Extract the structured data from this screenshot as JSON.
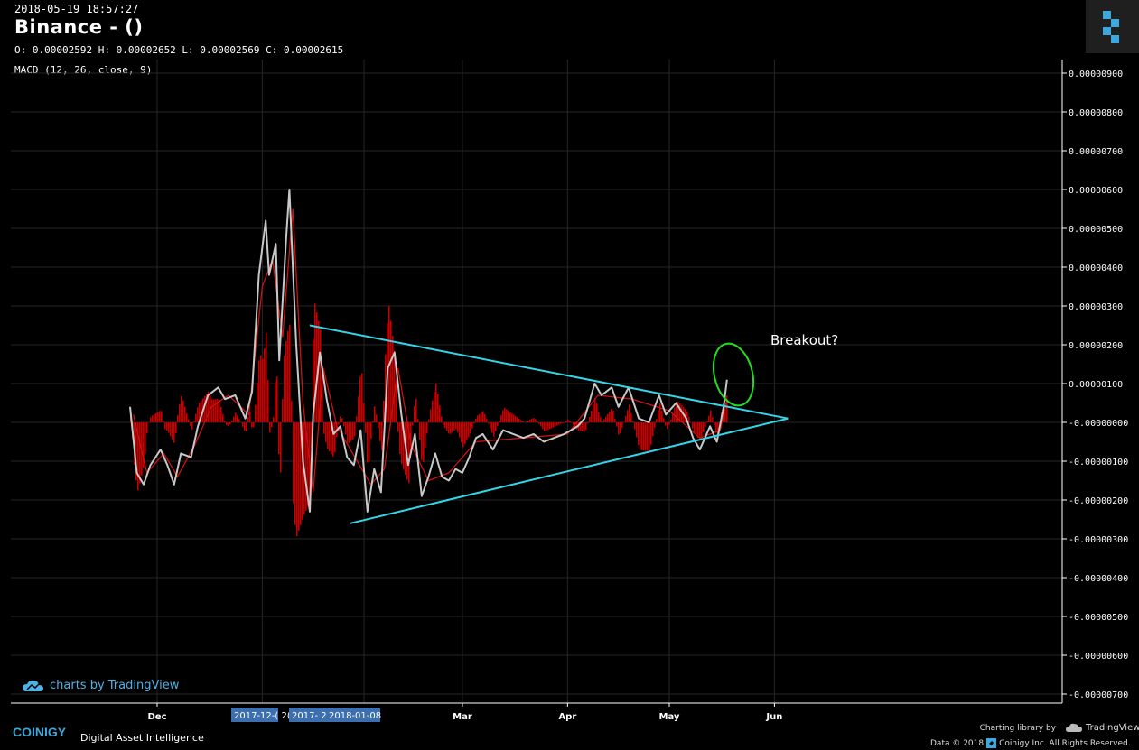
{
  "header": {
    "timestamp": "2018-05-19 18:57:27",
    "title": "Binance -  ()",
    "ohlc": "O: 0.00002592 H: 0.00002652 L: 0.00002569 C: 0.00002615",
    "indicator": "MACD (12, 26, close, 9)"
  },
  "annotation": {
    "text": "Breakout?"
  },
  "branding": {
    "tradingview": "charts by TradingView",
    "coinigy": "COINIGY",
    "tagline": "Digital Asset Intelligence",
    "charting_library": "Charting library by",
    "tv_name": "TradingView",
    "data_prefix": "Data © 2018",
    "rights": "Coinigy Inc. All Rights Reserved."
  },
  "colors": {
    "background": "#000000",
    "macd_line": "#c0c0c0",
    "signal_line": "#cc1111",
    "histogram": "#cc0000",
    "trendline": "#33d6e8",
    "breakout_circle": "#22dd22",
    "accent": "#3ba9dd"
  },
  "chart_data": {
    "type": "line",
    "title": "MACD (12, 26, close, 9)",
    "ylim": [
      -7.5e-07,
      9.5e-07
    ],
    "y_ticks": [
      "0.00000900",
      "0.00000800",
      "0.00000700",
      "0.00000600",
      "0.00000500",
      "0.00000400",
      "0.00000300",
      "0.00000200",
      "0.00000100",
      "-0.00000000",
      "-0.00000100",
      "-0.00000200",
      "-0.00000300",
      "-0.00000400",
      "-0.00000500",
      "-0.00000600",
      "-0.00000700"
    ],
    "y_tick_values": [
      9e-07,
      8e-07,
      7e-07,
      6e-07,
      5e-07,
      4e-07,
      3e-07,
      2e-07,
      1e-07,
      0,
      -1e-07,
      -2e-07,
      -3e-07,
      -4e-07,
      -5e-07,
      -6e-07,
      -7e-07
    ],
    "x_ticks": [
      {
        "label": "Dec",
        "date": "2017-12-01"
      },
      {
        "label": "Mar",
        "date": "2018-03-01"
      },
      {
        "label": "Apr",
        "date": "2018-04-01"
      },
      {
        "label": "May",
        "date": "2018-05-01"
      },
      {
        "label": "Jun",
        "date": "2018-06-01"
      }
    ],
    "x_highlight_labels": [
      "2017-12-( 2(",
      "2017- 2",
      "2018-01-08"
    ],
    "grid": true,
    "series": [
      {
        "name": "MACD",
        "points": [
          [
            "2017-11-23",
            4e-08
          ],
          [
            "2017-11-25",
            -1.3e-07
          ],
          [
            "2017-11-27",
            -1.6e-07
          ],
          [
            "2017-11-29",
            -1.1e-07
          ],
          [
            "2017-12-02",
            -7e-08
          ],
          [
            "2017-12-04",
            -1.1e-07
          ],
          [
            "2017-12-06",
            -1.6e-07
          ],
          [
            "2017-12-08",
            -8e-08
          ],
          [
            "2017-12-11",
            -9e-08
          ],
          [
            "2017-12-13",
            -1e-08
          ],
          [
            "2017-12-16",
            7e-08
          ],
          [
            "2017-12-19",
            9e-08
          ],
          [
            "2017-12-21",
            6e-08
          ],
          [
            "2017-12-24",
            7e-08
          ],
          [
            "2017-12-27",
            1e-08
          ],
          [
            "2017-12-29",
            8e-08
          ],
          [
            "2017-12-31",
            3.8e-07
          ],
          [
            "2018-01-02",
            5.2e-07
          ],
          [
            "2018-01-03",
            3.8e-07
          ],
          [
            "2018-01-05",
            4.6e-07
          ],
          [
            "2018-01-06",
            1.6e-07
          ],
          [
            "2018-01-08",
            4.7e-07
          ],
          [
            "2018-01-09",
            6e-07
          ],
          [
            "2018-01-11",
            2e-07
          ],
          [
            "2018-01-13",
            -1e-07
          ],
          [
            "2018-01-15",
            -2.3e-07
          ],
          [
            "2018-01-16",
            2e-08
          ],
          [
            "2018-01-18",
            1.8e-07
          ],
          [
            "2018-01-20",
            6e-08
          ],
          [
            "2018-01-22",
            -3e-08
          ],
          [
            "2018-01-24",
            -1e-08
          ],
          [
            "2018-01-26",
            -9e-08
          ],
          [
            "2018-01-28",
            -1.1e-07
          ],
          [
            "2018-01-30",
            -2e-08
          ],
          [
            "2018-02-01",
            -2.3e-07
          ],
          [
            "2018-02-03",
            -1.2e-07
          ],
          [
            "2018-02-05",
            -1.8e-07
          ],
          [
            "2018-02-07",
            1.4e-07
          ],
          [
            "2018-02-09",
            1.8e-07
          ],
          [
            "2018-02-11",
            2e-08
          ],
          [
            "2018-02-13",
            -1.1e-07
          ],
          [
            "2018-02-15",
            -3e-08
          ],
          [
            "2018-02-17",
            -1.9e-07
          ],
          [
            "2018-02-19",
            -1.4e-07
          ],
          [
            "2018-02-21",
            -8e-08
          ],
          [
            "2018-02-23",
            -1.4e-07
          ],
          [
            "2018-02-25",
            -1.5e-07
          ],
          [
            "2018-02-27",
            -1.2e-07
          ],
          [
            "2018-03-01",
            -1.3e-07
          ],
          [
            "2018-03-03",
            -9e-08
          ],
          [
            "2018-03-05",
            -4e-08
          ],
          [
            "2018-03-07",
            -3e-08
          ],
          [
            "2018-03-10",
            -7e-08
          ],
          [
            "2018-03-13",
            -2e-08
          ],
          [
            "2018-03-16",
            -3e-08
          ],
          [
            "2018-03-19",
            -4e-08
          ],
          [
            "2018-03-22",
            -3e-08
          ],
          [
            "2018-03-25",
            -5e-08
          ],
          [
            "2018-03-28",
            -4e-08
          ],
          [
            "2018-03-31",
            -3e-08
          ],
          [
            "2018-04-02",
            -2e-08
          ],
          [
            "2018-04-04",
            -1e-08
          ],
          [
            "2018-04-06",
            1e-08
          ],
          [
            "2018-04-09",
            1e-07
          ],
          [
            "2018-04-11",
            7e-08
          ],
          [
            "2018-04-14",
            9e-08
          ],
          [
            "2018-04-16",
            4e-08
          ],
          [
            "2018-04-19",
            9e-08
          ],
          [
            "2018-04-22",
            1e-08
          ],
          [
            "2018-04-25",
            0.0
          ],
          [
            "2018-04-28",
            7e-08
          ],
          [
            "2018-04-30",
            2e-08
          ],
          [
            "2018-05-03",
            5e-08
          ],
          [
            "2018-05-06",
            1e-08
          ],
          [
            "2018-05-08",
            -4e-08
          ],
          [
            "2018-05-10",
            -7e-08
          ],
          [
            "2018-05-13",
            -1e-08
          ],
          [
            "2018-05-15",
            -5e-08
          ],
          [
            "2018-05-17",
            4e-08
          ],
          [
            "2018-05-18",
            1.1e-07
          ]
        ]
      },
      {
        "name": "Signal",
        "points": [
          [
            "2017-11-24",
            2e-08
          ],
          [
            "2017-11-28",
            -1.3e-07
          ],
          [
            "2017-12-03",
            -8e-08
          ],
          [
            "2017-12-07",
            -1.4e-07
          ],
          [
            "2017-12-12",
            -6e-08
          ],
          [
            "2017-12-17",
            4e-08
          ],
          [
            "2017-12-22",
            7e-08
          ],
          [
            "2017-12-28",
            2e-08
          ],
          [
            "2018-01-01",
            3.5e-07
          ],
          [
            "2018-01-04",
            4.2e-07
          ],
          [
            "2018-01-07",
            2.2e-07
          ],
          [
            "2018-01-10",
            5.5e-07
          ],
          [
            "2018-01-13",
            5e-08
          ],
          [
            "2018-01-16",
            -1.8e-07
          ],
          [
            "2018-01-19",
            1.4e-07
          ],
          [
            "2018-01-23",
            -1e-08
          ],
          [
            "2018-01-29",
            -1e-07
          ],
          [
            "2018-02-02",
            -1.6e-07
          ],
          [
            "2018-02-06",
            -1.2e-07
          ],
          [
            "2018-02-10",
            1.4e-07
          ],
          [
            "2018-02-14",
            -6e-08
          ],
          [
            "2018-02-19",
            -1.5e-07
          ],
          [
            "2018-02-25",
            -1.3e-07
          ],
          [
            "2018-03-05",
            -5e-08
          ],
          [
            "2018-03-19",
            -4e-08
          ],
          [
            "2018-04-01",
            -3e-08
          ],
          [
            "2018-04-10",
            7e-08
          ],
          [
            "2018-04-20",
            6e-08
          ],
          [
            "2018-05-01",
            3e-08
          ],
          [
            "2018-05-10",
            -4e-08
          ],
          [
            "2018-05-16",
            -2e-08
          ],
          [
            "2018-05-18",
            6e-08
          ]
        ]
      }
    ],
    "trendlines": [
      {
        "from": [
          "2018-01-15",
          2.5e-07
        ],
        "to": [
          "2018-06-05",
          1e-08
        ]
      },
      {
        "from": [
          "2018-01-27",
          -2.6e-07
        ],
        "to": [
          "2018-06-05",
          1e-08
        ]
      }
    ]
  }
}
